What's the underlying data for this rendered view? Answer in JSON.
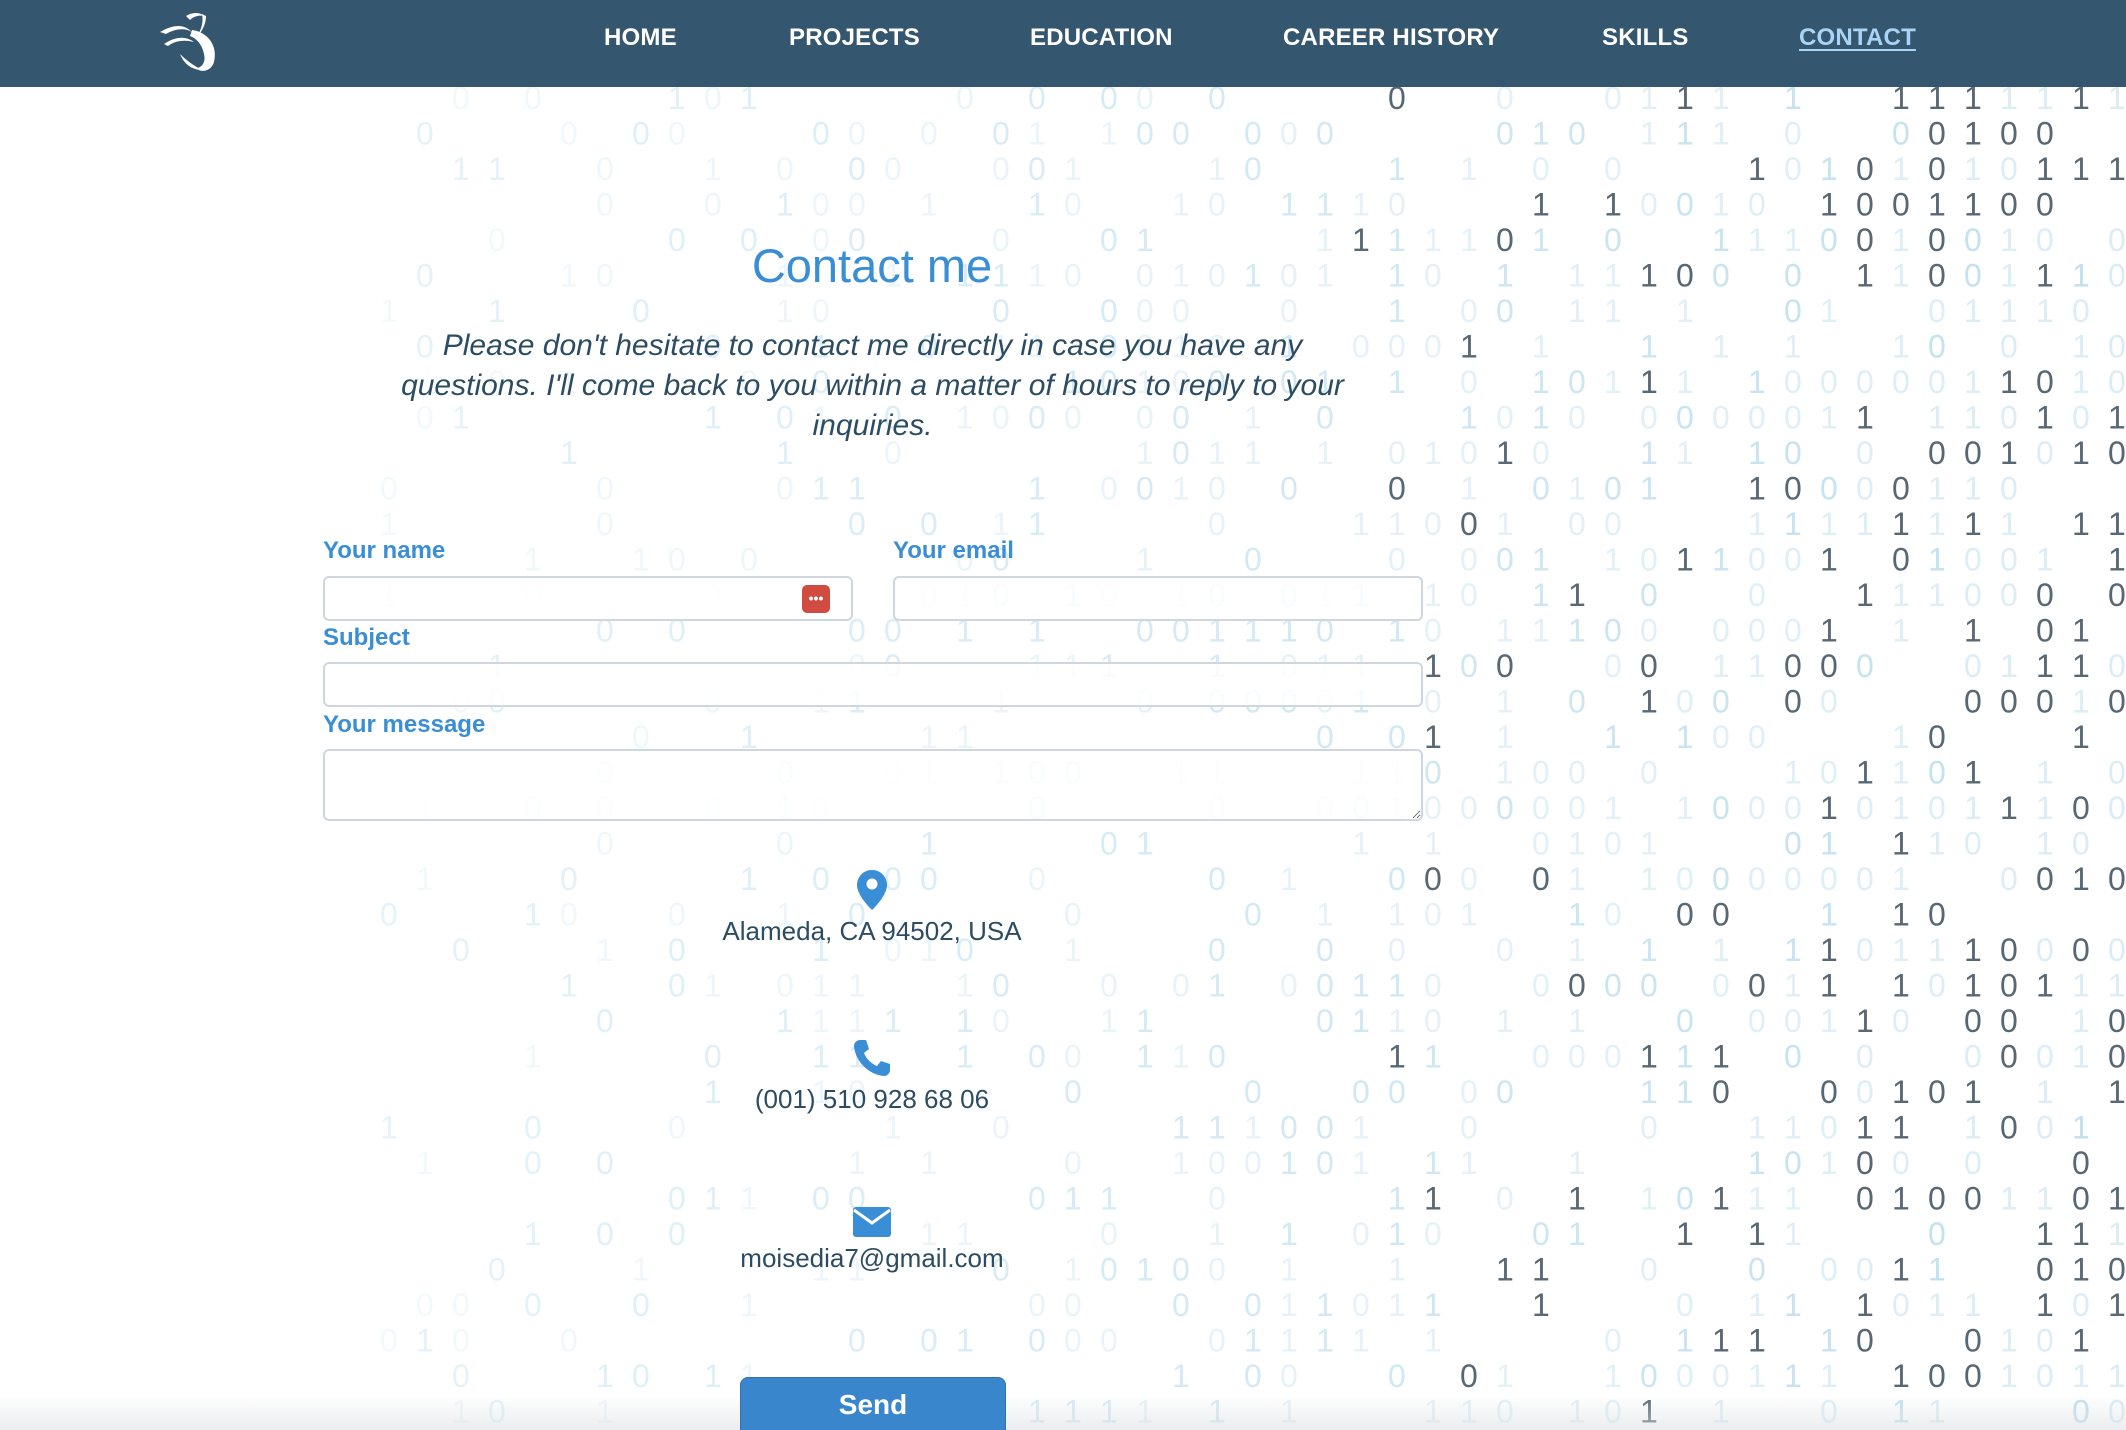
{
  "nav": {
    "items": [
      {
        "label": "HOME"
      },
      {
        "label": "PROJECTS"
      },
      {
        "label": "EDUCATION"
      },
      {
        "label": "CAREER HISTORY"
      },
      {
        "label": "SKILLS"
      },
      {
        "label": "CONTACT",
        "active": true
      }
    ]
  },
  "contact": {
    "title": "Contact me",
    "intro": "Please don't hesitate to contact me directly in case you have any questions. I'll come back to you within a matter of hours to reply to your inquiries."
  },
  "form": {
    "name_label": "Your name",
    "name_value": "",
    "email_label": "Your email",
    "email_value": "",
    "subject_label": "Subject",
    "subject_value": "",
    "message_label": "Your message",
    "message_value": "",
    "password_manager_icon": "•••",
    "send_label": "Send"
  },
  "info": {
    "address": "Alameda, CA 94502, USA",
    "phone": "(001) 510 928 68 06",
    "email": "moisedia7@gmail.com"
  },
  "colors": {
    "navbar": "#35566f",
    "accent": "#3a8ed6",
    "text_dark": "#2c4c63",
    "active_nav": "#a9d4f5",
    "password_icon": "#d14b40"
  },
  "icons": {
    "logo": "stylized-bird-logo",
    "address": "map-pin-icon",
    "phone": "phone-icon",
    "email": "envelope-icon"
  }
}
